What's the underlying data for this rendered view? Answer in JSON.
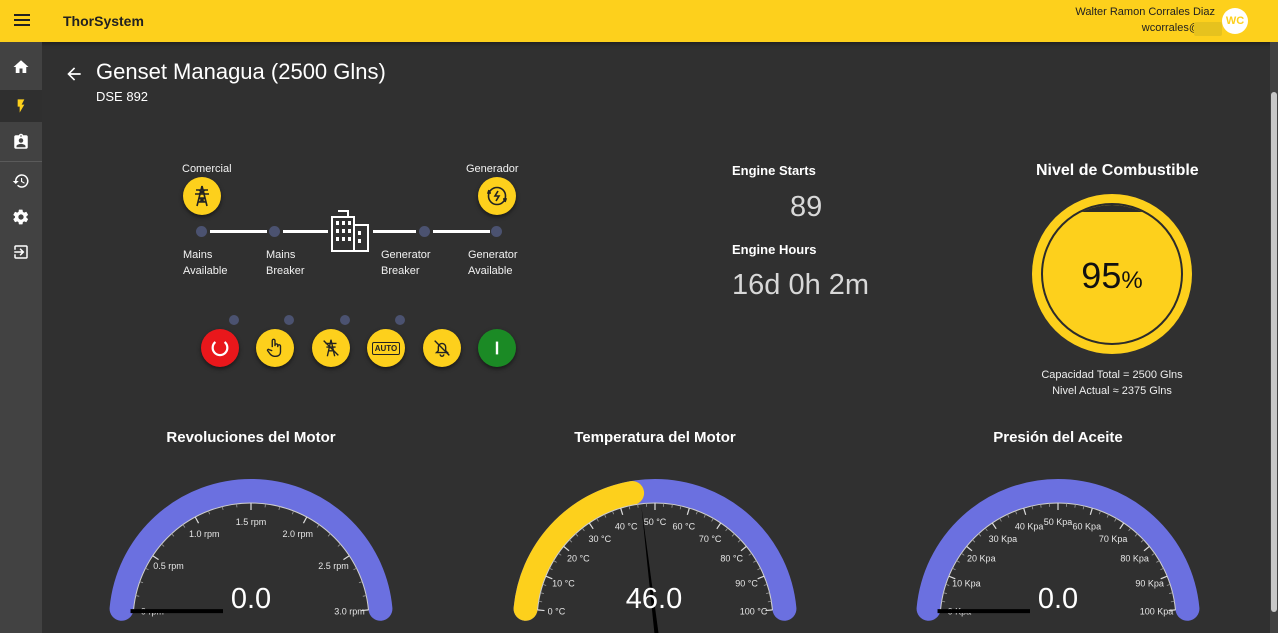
{
  "app": {
    "title": "ThorSystem"
  },
  "user": {
    "name": "Walter Ramon Corrales Diaz",
    "email": "wcorrales@",
    "initials": "WC"
  },
  "sidebar": {
    "items": [
      {
        "icon": "home-icon"
      },
      {
        "icon": "bolt-icon",
        "active": true
      },
      {
        "icon": "assignment-icon"
      },
      {
        "icon": "history-icon"
      },
      {
        "icon": "gear-icon"
      },
      {
        "icon": "logout-icon"
      }
    ]
  },
  "header": {
    "title": "Genset Managua (2500 Glns)",
    "subtitle": "DSE 892"
  },
  "diagram": {
    "mains_label": "Comercial",
    "generator_label": "Generador",
    "nodes": [
      {
        "line1": "Mains",
        "line2": "Available"
      },
      {
        "line1": "Mains",
        "line2": "Breaker"
      },
      {
        "line1": "Generator",
        "line2": "Breaker"
      },
      {
        "line1": "Generator",
        "line2": "Available"
      }
    ]
  },
  "controls": [
    {
      "name": "stop",
      "color": "#e9171b"
    },
    {
      "name": "manual",
      "color": "#fdd01c"
    },
    {
      "name": "test",
      "color": "#fdd01c"
    },
    {
      "name": "auto",
      "color": "#fdd01c",
      "label": "AUTO"
    },
    {
      "name": "alarm-mute",
      "color": "#fdd01c"
    },
    {
      "name": "start",
      "color": "#1b8a25"
    }
  ],
  "engine": {
    "starts_label": "Engine Starts",
    "starts_value": "89",
    "hours_label": "Engine Hours",
    "hours_value": "16d 0h 2m"
  },
  "fuel": {
    "title": "Nivel de Combustible",
    "percent": 95,
    "value_text": "95",
    "unit": "%",
    "capacity_text": "Capacidad Total = 2500 Glns",
    "level_text": "Nivel Actual ≈ 2375 Glns"
  },
  "gauges": [
    {
      "title": "Revoluciones del Motor",
      "value_text": "0.0",
      "value": 0,
      "min": 0,
      "max": 3,
      "ticks": [
        "0 rpm",
        "0.5 rpm",
        "1.0 rpm",
        "1.5 rpm",
        "2.0 rpm",
        "2.5 rpm",
        "3.0 rpm"
      ],
      "yellow_until": 0,
      "colors": {
        "band": "#6b70e0",
        "warn": "#fdd01c",
        "needle": "#000000"
      }
    },
    {
      "title": "Temperatura del Motor",
      "value_text": "46.0",
      "value": 46,
      "min": 0,
      "max": 100,
      "ticks": [
        "0 °C",
        "10 °C",
        "20 °C",
        "30 °C",
        "40 °C",
        "50 °C",
        "60 °C",
        "70 °C",
        "80 °C",
        "90 °C",
        "100 °C"
      ],
      "yellow_until": 44,
      "colors": {
        "band": "#6b70e0",
        "warn": "#fdd01c",
        "needle": "#000000"
      }
    },
    {
      "title": "Presión del Aceite",
      "value_text": "0.0",
      "value": 0,
      "min": 0,
      "max": 100,
      "ticks": [
        "0 Kpa",
        "10 Kpa",
        "20 Kpa",
        "30 Kpa",
        "40 Kpa",
        "50 Kpa",
        "60 Kpa",
        "70 Kpa",
        "80 Kpa",
        "90 Kpa",
        "100 Kpa"
      ],
      "yellow_until": 0,
      "colors": {
        "band": "#6b70e0",
        "warn": "#fdd01c",
        "needle": "#000000"
      }
    }
  ]
}
